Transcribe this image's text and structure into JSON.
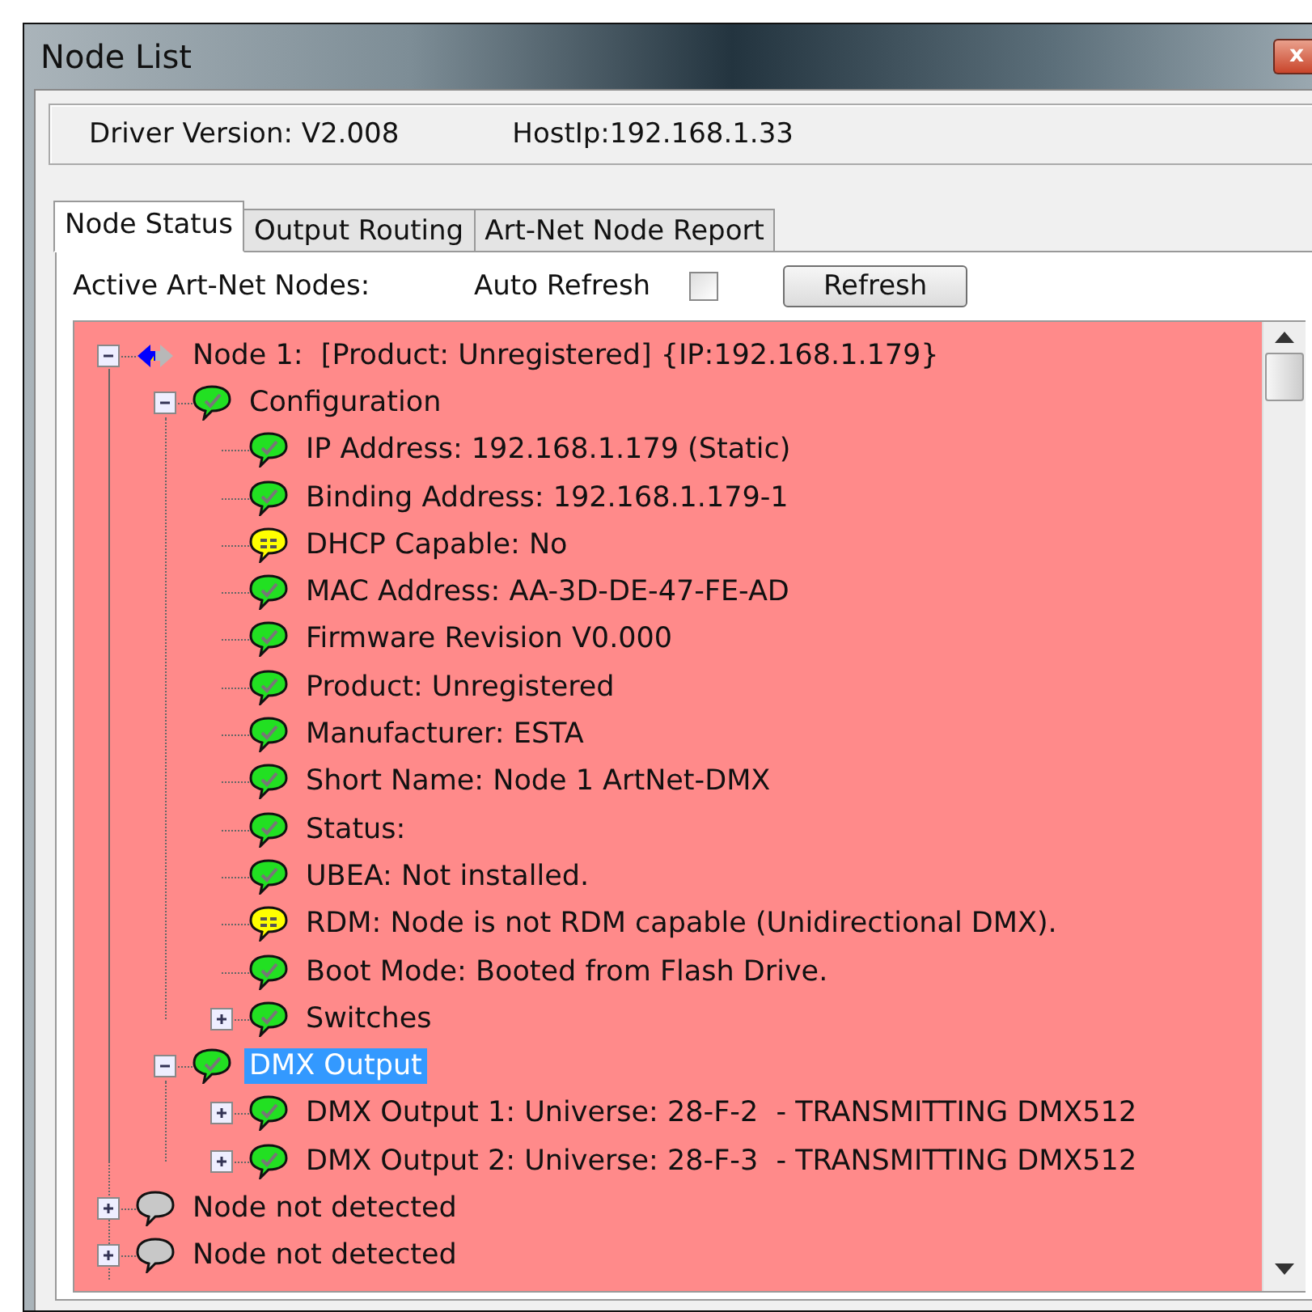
{
  "window": {
    "title": "Node List",
    "close": "x"
  },
  "info": {
    "driver_version": "Driver Version: V2.008",
    "host_ip": "HostIp:192.168.1.33"
  },
  "tabs": [
    {
      "label": "Node Status",
      "selected": true
    },
    {
      "label": "Output Routing",
      "selected": false
    },
    {
      "label": "Art-Net Node Report",
      "selected": false
    }
  ],
  "toolbar": {
    "label": "Active Art-Net Nodes:",
    "auto_refresh": {
      "label": "Auto Refresh",
      "checked": false
    },
    "refresh_button": "Refresh"
  },
  "tree": [
    {
      "text": "Node 1:  [Product: Unregistered] {IP:192.168.1.179}",
      "kind": "node",
      "expanded": true,
      "selected": false,
      "children": [
        {
          "text": "Configuration",
          "kind": "ok",
          "expanded": true,
          "selected": false,
          "children": [
            {
              "text": "IP Address: 192.168.1.179 (Static)",
              "kind": "ok",
              "selected": false
            },
            {
              "text": "Binding Address: 192.168.1.179-1",
              "kind": "ok",
              "selected": false
            },
            {
              "text": "DHCP Capable: No",
              "kind": "warn",
              "selected": false
            },
            {
              "text": "MAC Address: AA-3D-DE-47-FE-AD",
              "kind": "ok",
              "selected": false
            },
            {
              "text": "Firmware Revision V0.000",
              "kind": "ok",
              "selected": false
            },
            {
              "text": "Product: Unregistered",
              "kind": "ok",
              "selected": false
            },
            {
              "text": "Manufacturer: ESTA",
              "kind": "ok",
              "selected": false
            },
            {
              "text": "Short Name: Node 1 ArtNet-DMX",
              "kind": "ok",
              "selected": false
            },
            {
              "text": "Status:",
              "kind": "ok",
              "selected": false
            },
            {
              "text": "UBEA: Not installed.",
              "kind": "ok",
              "selected": false
            },
            {
              "text": "RDM: Node is not RDM capable (Unidirectional DMX).",
              "kind": "warn",
              "selected": false
            },
            {
              "text": "Boot Mode: Booted from Flash Drive.",
              "kind": "ok",
              "selected": false
            },
            {
              "text": "Switches",
              "kind": "ok",
              "expanded": false,
              "selected": false
            }
          ]
        },
        {
          "text": "DMX Output",
          "kind": "ok",
          "expanded": true,
          "selected": true,
          "children": [
            {
              "text": "DMX Output 1: Universe: 28-F-2  - TRANSMITTING DMX512",
              "kind": "ok",
              "expanded": false,
              "selected": false
            },
            {
              "text": "DMX Output 2: Universe: 28-F-3  - TRANSMITTING DMX512",
              "kind": "ok",
              "expanded": false,
              "selected": false
            }
          ]
        }
      ]
    },
    {
      "text": "Node not detected",
      "kind": "none",
      "expanded": false,
      "selected": false
    },
    {
      "text": "Node not detected",
      "kind": "none",
      "expanded": false,
      "selected": false
    }
  ]
}
